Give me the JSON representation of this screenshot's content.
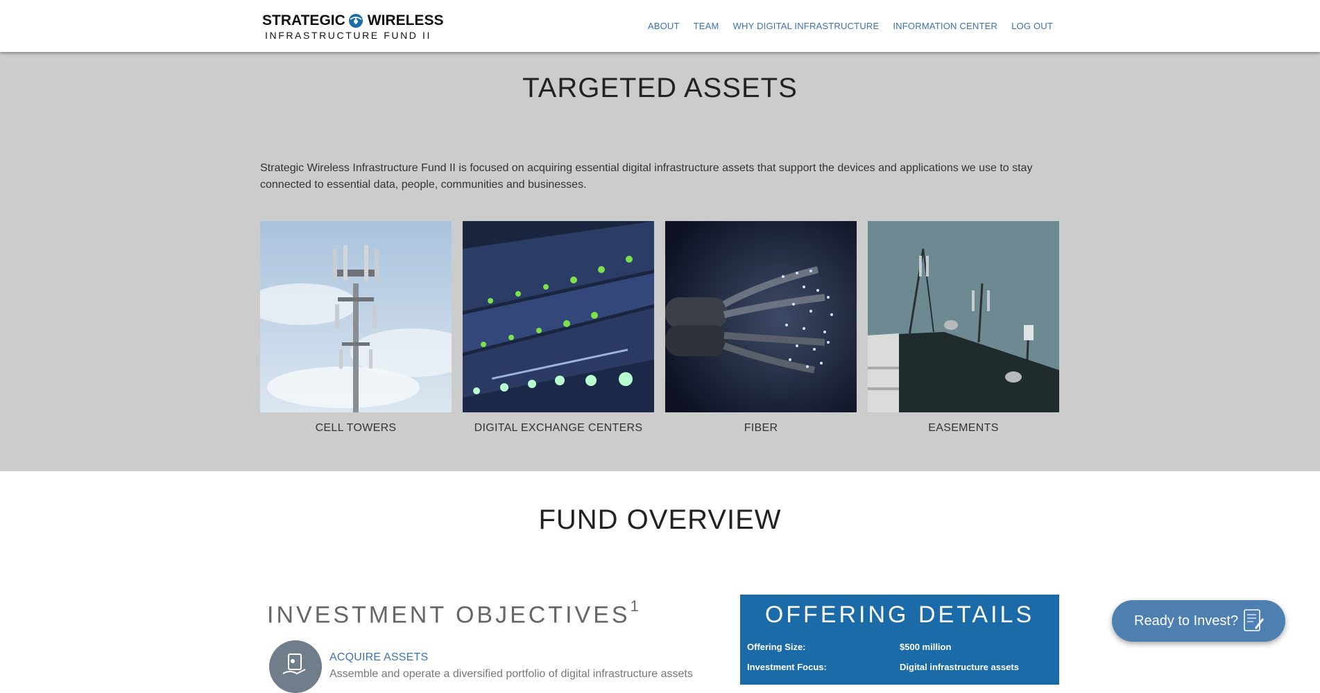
{
  "header": {
    "logo_line1_a": "STRATEGIC",
    "logo_line1_b": "WIRELESS",
    "logo_line2": "INFRASTRUCTURE FUND II",
    "nav": [
      {
        "label": "ABOUT"
      },
      {
        "label": "TEAM"
      },
      {
        "label": "WHY DIGITAL INFRASTRUCTURE"
      },
      {
        "label": "INFORMATION CENTER"
      },
      {
        "label": "LOG OUT"
      }
    ]
  },
  "assets": {
    "title": "TARGETED ASSETS",
    "intro": "Strategic Wireless Infrastructure Fund II is focused on acquiring essential digital infrastructure assets that support the devices and applications we use to stay connected to essential data, people, communities and businesses.",
    "cards": [
      {
        "label": "CELL TOWERS"
      },
      {
        "label": "DIGITAL EXCHANGE CENTERS"
      },
      {
        "label": "FIBER"
      },
      {
        "label": "EASEMENTS"
      }
    ]
  },
  "overview": {
    "title": "FUND OVERVIEW",
    "objectives_title": "INVESTMENT OBJECTIVES",
    "objectives_sup": "1",
    "objective_heading": "ACQUIRE ASSETS",
    "objective_text": "Assemble and operate a diversified portfolio of digital infrastructure assets",
    "offering_title": "OFFERING DETAILS",
    "offering_rows": [
      {
        "label": "Offering Size:",
        "value": "$500 million"
      },
      {
        "label": "Investment Focus:",
        "value": "Digital infrastructure assets"
      }
    ]
  },
  "cta": {
    "label": "Ready to Invest?"
  },
  "colors": {
    "accent": "#3a73b5",
    "section_bg": "#cccccc",
    "offering_bg": "#1a6ba8",
    "cta_bg": "#4d7fb1"
  }
}
